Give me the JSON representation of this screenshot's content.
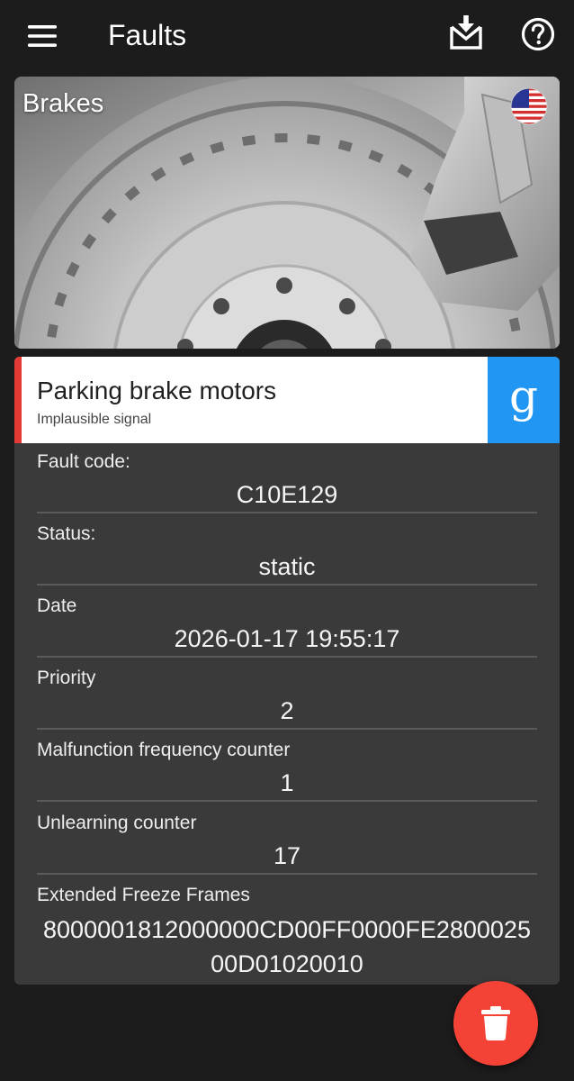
{
  "app": {
    "title": "Faults"
  },
  "toolbar": {
    "menu_icon": "hamburger-menu-icon",
    "download_icon": "download-tray-icon",
    "help_icon": "help-circle-icon"
  },
  "banner": {
    "category": "Brakes",
    "flag_icon": "us-flag-icon"
  },
  "fault": {
    "name": "Parking brake motors",
    "description": "Implausible signal",
    "accent_color": "#e53935",
    "search_icon": "google-g-icon",
    "search_color": "#2196f3"
  },
  "fields": [
    {
      "label": "Fault code:",
      "value": "C10E129"
    },
    {
      "label": "Status:",
      "value": "static"
    },
    {
      "label": "Date",
      "value": "2026-01-17 19:55:17"
    },
    {
      "label": "Priority",
      "value": "2"
    },
    {
      "label": "Malfunction frequency counter",
      "value": "1"
    },
    {
      "label": "Unlearning counter",
      "value": "17"
    },
    {
      "label": "Extended Freeze Frames",
      "value": "8000001812000000CD00FF0000FE280002500D01020010"
    }
  ],
  "fab": {
    "icon": "trash-icon",
    "color": "#f44336"
  }
}
